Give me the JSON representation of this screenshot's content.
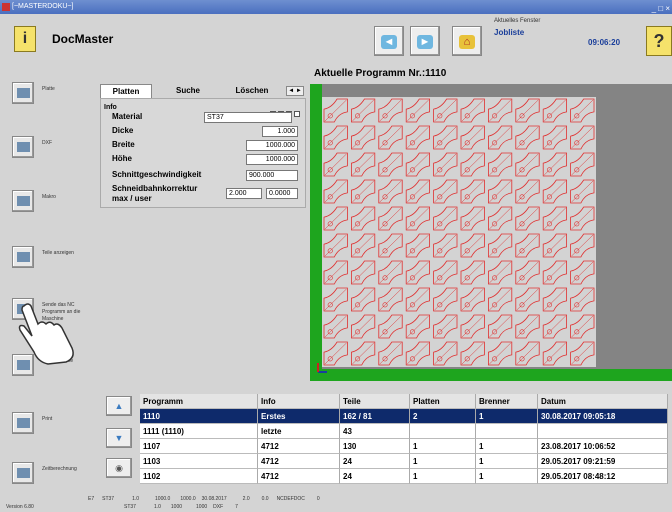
{
  "window": {
    "title": "[~MASTERDOKU~]",
    "controls": "_ □ ×"
  },
  "header": {
    "app_title": "DocMaster",
    "help_left_icon": "info-help-icon",
    "back_icon": "arrow-left-icon",
    "forward_icon": "arrow-right-icon",
    "home_icon": "home-icon",
    "current_window_label": "Aktuelles Fenster",
    "current_window_value": "Jobliste",
    "time": "09:06:20",
    "help_right_label": "?"
  },
  "sidebar": {
    "items": [
      {
        "label": "Platte",
        "icon": "plate-icon"
      },
      {
        "label": "DXF",
        "icon": "dxf-icon"
      },
      {
        "label": "Makro",
        "icon": "macro-icon"
      },
      {
        "label": "Teile anzeigen",
        "icon": "parts-icon"
      },
      {
        "label": "Sende das NC Programm an die Maschine",
        "icon": "send-nc-icon"
      },
      {
        "label": "Nächste Seite",
        "icon": "next-page-icon"
      },
      {
        "label": "Print",
        "icon": "print-icon"
      },
      {
        "label": "Zeitberechnung",
        "icon": "time-calc-icon"
      }
    ]
  },
  "tabs": [
    {
      "label": "Platten",
      "active": true
    },
    {
      "label": "Suche",
      "active": false
    },
    {
      "label": "Löschen",
      "active": false
    }
  ],
  "tab_scroll": "◄ ►",
  "info": {
    "title": "Info",
    "material_label": "Material",
    "material_value": "ST37",
    "dicke_label": "Dicke",
    "dicke_value": "1.000",
    "breite_label": "Breite",
    "breite_value": "1000.000",
    "hoehe_label": "Höhe",
    "hoehe_value": "1000.000",
    "speed_label": "Schnittgeschwindigkeit",
    "speed_value": "900.000",
    "kerf_label_1": "Schneidbahnkorrektur",
    "kerf_label_2": "max / user",
    "kerf_max": "2.000",
    "kerf_user": "0.0000"
  },
  "program": {
    "title": "Aktuelle Programm Nr.:1110",
    "grid_rows": 10,
    "grid_cols": 10,
    "part_color": "#e03030",
    "frame_color": "#1ea51e"
  },
  "table": {
    "headers": [
      "Programm",
      "Info",
      "Teile",
      "Platten",
      "Brenner",
      "Datum"
    ],
    "rows": [
      [
        "1110",
        "Erstes",
        "162 / 81",
        "2",
        "1",
        "30.08.2017 09:05:18"
      ],
      [
        "1111 (1110)",
        "letzte",
        "43",
        "",
        "",
        ""
      ],
      [
        "1107",
        "4712",
        "130",
        "1",
        "1",
        "23.08.2017 10:06:52"
      ],
      [
        "1103",
        "4712",
        "24",
        "1",
        "1",
        "29.05.2017 09:21:59"
      ],
      [
        "1102",
        "4712",
        "24",
        "1",
        "1",
        "29.05.2017 08:48:12"
      ]
    ],
    "selected_row": 0,
    "scroll_up_icon": "arrow-up-icon",
    "scroll_down_icon": "arrow-down-icon",
    "eye_icon": "preview-icon"
  },
  "status": {
    "row1": [
      "E7",
      "ST37",
      "1.0",
      "1000.0",
      "1000.0",
      "30.08.2017",
      "2.0",
      "0.0",
      "NCDEFDOC",
      "0"
    ],
    "row2": [
      "ST37",
      "1.0",
      "1000",
      "1000",
      "DXF",
      "7"
    ],
    "version": "Version 6.80"
  }
}
